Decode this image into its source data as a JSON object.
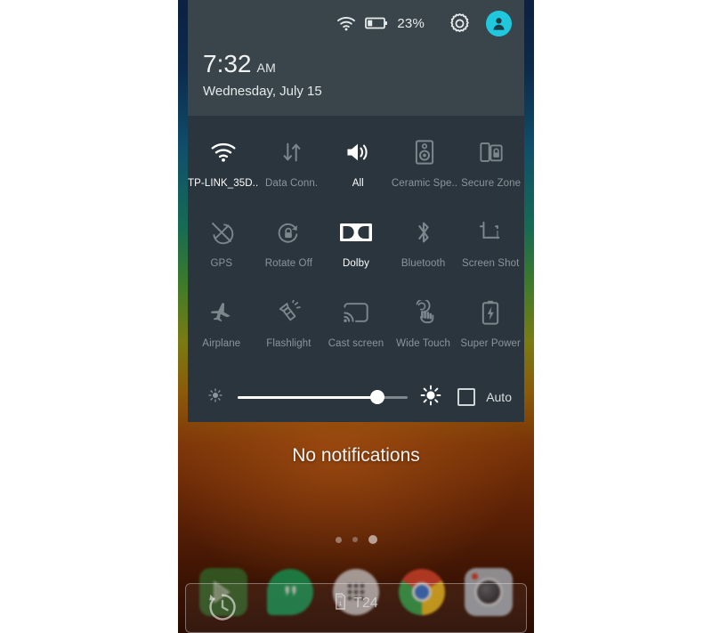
{
  "statusbar": {
    "wifi_icon": "wifi-icon",
    "battery_icon": "battery-low-icon",
    "battery_percent": "23%",
    "settings_icon": "gear-icon",
    "avatar_icon": "user-avatar-icon"
  },
  "header": {
    "time": "7:32",
    "ampm": "AM",
    "date": "Wednesday, July 15"
  },
  "quick_settings": {
    "rows": [
      [
        {
          "label": "TP-LINK_35D..",
          "icon": "wifi-icon",
          "active": true
        },
        {
          "label": "Data Conn.",
          "icon": "data-transfer-icon",
          "active": false
        },
        {
          "label": "All",
          "icon": "volume-on-icon",
          "active": true
        },
        {
          "label": "Ceramic Spe..",
          "icon": "ceramic-speaker-icon",
          "active": false
        },
        {
          "label": "Secure Zone",
          "icon": "secure-zone-icon",
          "active": false
        }
      ],
      [
        {
          "label": "GPS",
          "icon": "gps-off-icon",
          "active": false
        },
        {
          "label": "Rotate Off",
          "icon": "rotation-lock-icon",
          "active": false
        },
        {
          "label": "Dolby",
          "icon": "dolby-icon",
          "active": true
        },
        {
          "label": "Bluetooth",
          "icon": "bluetooth-icon",
          "active": false
        },
        {
          "label": "Screen Shot",
          "icon": "screenshot-crop-icon",
          "active": false
        }
      ],
      [
        {
          "label": "Airplane",
          "icon": "airplane-icon",
          "active": false
        },
        {
          "label": "Flashlight",
          "icon": "flashlight-icon",
          "active": false
        },
        {
          "label": "Cast screen",
          "icon": "cast-screen-icon",
          "active": false
        },
        {
          "label": "Wide Touch",
          "icon": "wide-touch-icon",
          "active": false
        },
        {
          "label": "Super Power",
          "icon": "super-power-battery-icon",
          "active": false
        }
      ]
    ]
  },
  "brightness": {
    "low_icon": "brightness-low-icon",
    "high_icon": "brightness-high-icon",
    "value_percent": 82,
    "auto_label": "Auto",
    "auto_checked": false
  },
  "notifications": {
    "empty_message": "No notifications"
  },
  "home": {
    "page_dots_count": 3,
    "active_dot_index": 2,
    "dock": [
      {
        "name": "play-store",
        "icon": "play-store-icon"
      },
      {
        "name": "hangouts",
        "icon": "hangouts-icon"
      },
      {
        "name": "app-drawer",
        "icon": "app-drawer-icon"
      },
      {
        "name": "chrome",
        "icon": "chrome-icon"
      },
      {
        "name": "camera",
        "icon": "camera-icon"
      }
    ]
  },
  "capture_overlay": {
    "rotate_icon": "rotate-capture-icon",
    "storage_icon": "sd-card-icon",
    "storage_label": "T24"
  },
  "colors": {
    "header_bg": "#3a454b",
    "tiles_bg": "#2b353d",
    "accent_avatar": "#1fc8dd",
    "tile_label": "#8b959c",
    "tile_label_active": "#ffffff"
  }
}
